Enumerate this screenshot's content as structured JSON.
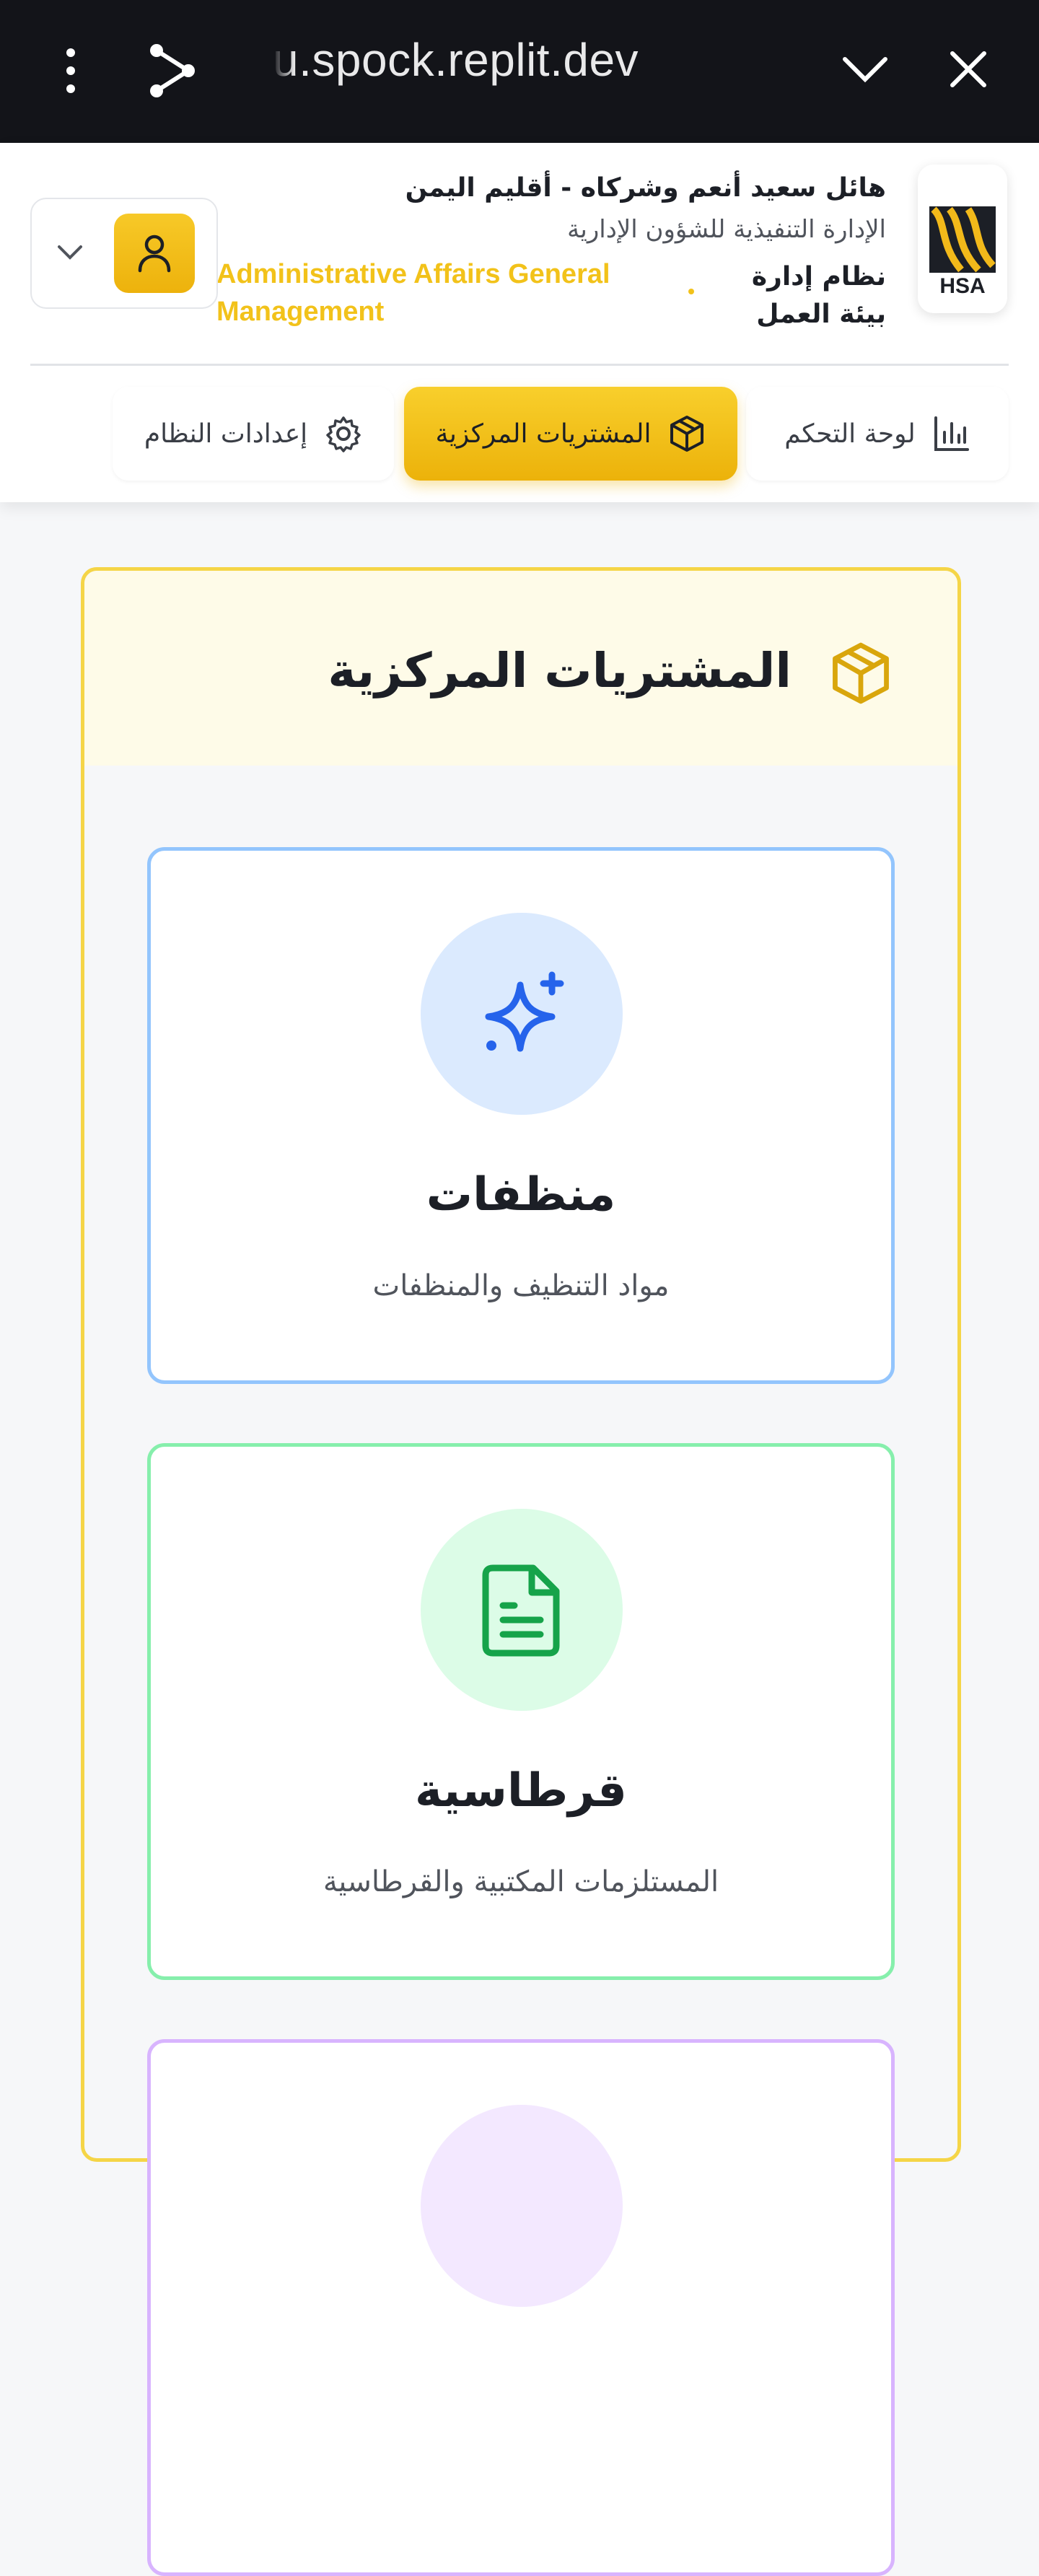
{
  "browser": {
    "url": "u.spock.replit.dev",
    "icons": [
      "more-vert-icon",
      "share-icon",
      "chevron-down-icon",
      "close-icon"
    ]
  },
  "header": {
    "org_title": "هائل سعيد أنعم وشركاه - أقليم اليمن",
    "org_subtitle": "الإدارة التنفيذية للشؤون الإدارية",
    "system_name": "نظام إدارة بيئة العمل",
    "department_en": "Administrative Affairs General Management",
    "logo_text": "HSA"
  },
  "nav": {
    "items": [
      {
        "label": "لوحة التحكم",
        "icon": "bar-chart-icon"
      },
      {
        "label": "المشتريات المركزية",
        "icon": "package-icon",
        "active": true
      },
      {
        "label": "إعدادات النظام",
        "icon": "gear-icon"
      }
    ]
  },
  "main": {
    "title": "المشتريات المركزية",
    "categories": [
      {
        "name": "منظفات",
        "description": "مواد التنظيف والمنظفات",
        "icon": "sparkles-icon",
        "accent": "#2563eb"
      },
      {
        "name": "قرطاسية",
        "description": "المستلزمات المكتبية والقرطاسية",
        "icon": "file-text-icon",
        "accent": "#16a34a"
      },
      {
        "name": "",
        "description": "",
        "icon": "",
        "accent": "#a855f7"
      }
    ]
  },
  "colors": {
    "brand_yellow": "#f2c21a",
    "chrome_bg": "#131419"
  }
}
